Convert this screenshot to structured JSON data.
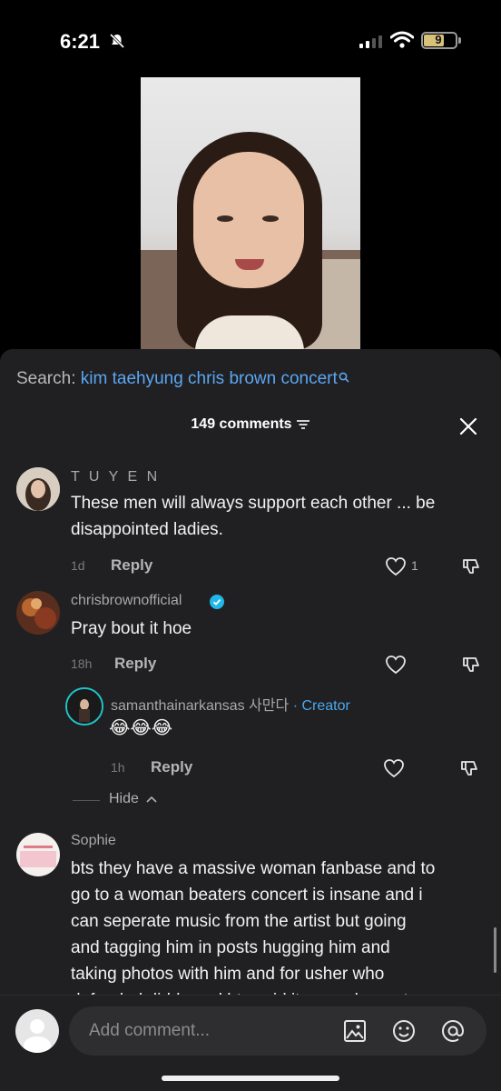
{
  "status_bar": {
    "time": "6:21",
    "battery": "9"
  },
  "search": {
    "label": "Search:",
    "query": "kim taehyung chris brown concert"
  },
  "comments_header": {
    "count_label": "149 comments"
  },
  "comments": [
    {
      "username": "T U Y E N",
      "text_line1": "These men will always support each other ... be",
      "text_line2": "disappointed ladies.",
      "time": "1d",
      "reply": "Reply",
      "likes": "1"
    },
    {
      "username": "chrisbrownofficial",
      "text": "Pray bout it hoe",
      "time": "18h",
      "reply": "Reply"
    },
    {
      "username": "samanthainarkansas 사만다",
      "creator": "· Creator",
      "text": "😂😂😂",
      "time": "1h",
      "reply": "Reply"
    },
    {
      "username": "Sophie",
      "lines": [
        "bts they have a massive woman fanbase and to",
        "go to a woman beaters concert is insane and i",
        "can seperate music from the artist but going",
        "and tagging him in posts hugging him and",
        "taking photos with him and for usher who",
        "defended diddy and bts said it was a honor to"
      ]
    }
  ],
  "hide_label": "Hide",
  "composer": {
    "placeholder": "Add comment..."
  },
  "colors": {
    "sheet": "#202022",
    "link": "#5ba6f2",
    "verified": "#20b8e8"
  }
}
